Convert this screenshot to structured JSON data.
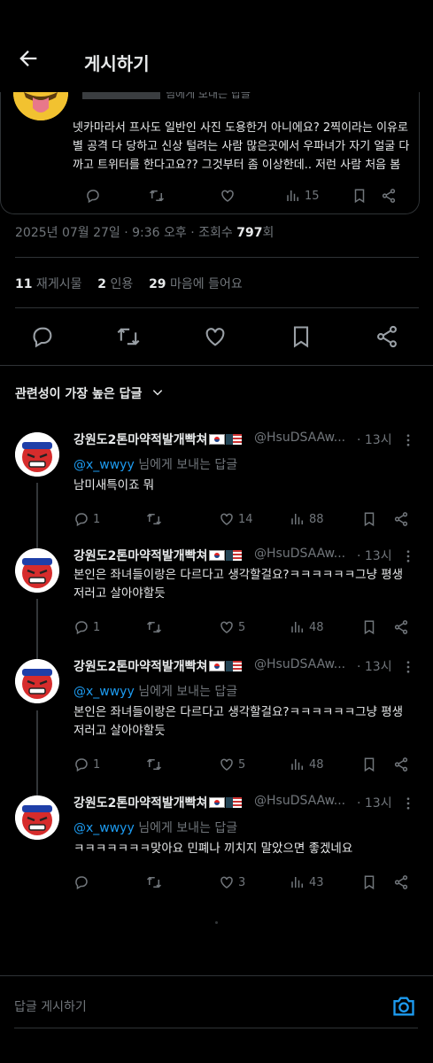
{
  "header": {
    "title": "게시하기"
  },
  "quoted": {
    "reply_to": "님에게 보내는 답글",
    "text": "넷카마라서 프사도 일반인 사진 도용한거 아니에요? 2찍이라는 이유로 별 공격 다 당하고 신상 털려는 사람 많은곳에서 우파녀가 자기 얼굴 다 까고 트위터를 한다고요?? 그것부터 좀 이상한데.. 저런 사람 처음 봄",
    "views": "15"
  },
  "meta": {
    "datetime": "2025년 07월 27일 · 9:36 오후 · 조회수 ",
    "views": "797",
    "views_unit": "회"
  },
  "stats": {
    "reposts_count": "11",
    "reposts_label": " 재게시물",
    "quotes_count": "2",
    "quotes_label": " 인용",
    "likes_count": "29",
    "likes_label": " 마음에 들어요"
  },
  "sort": {
    "label": "관련성이 가장 높은 답글"
  },
  "replies": [
    {
      "name": "강원도2톤마약적발개빡쳐",
      "handle": "@HsuDSAAw...",
      "time": "· 13시",
      "mention": "@x_wwyy",
      "reply_to": " 님에게 보내는 답글",
      "text": "남미새특이죠 뭐",
      "replies": "1",
      "likes": "14",
      "views": "88"
    },
    {
      "name": "강원도2톤마약적발개빡쳐",
      "handle": "@HsuDSAAw...",
      "time": "· 13시",
      "mention": "",
      "reply_to": "",
      "text": "본인은 좌녀들이랑은 다르다고 생각할걸요?ㅋㅋㅋㅋㅋㅋ그냥 평생 저러고 살아야할듯",
      "replies": "1",
      "likes": "5",
      "views": "48"
    },
    {
      "name": "강원도2톤마약적발개빡쳐",
      "handle": "@HsuDSAAw...",
      "time": "· 13시",
      "mention": "@x_wwyy",
      "reply_to": " 님에게 보내는 답글",
      "text": "본인은 좌녀들이랑은 다르다고 생각할걸요?ㅋㅋㅋㅋㅋㅋ그냥 평생 저러고 살아야할듯",
      "replies": "1",
      "likes": "5",
      "views": "48"
    },
    {
      "name": "강원도2톤마약적발개빡쳐",
      "handle": "@HsuDSAAw...",
      "time": "· 13시",
      "mention": "@x_wwyy",
      "reply_to": " 님에게 보내는 답글",
      "text": "ㅋㅋㅋㅋㅋㅋㅋ맞아요 민폐나 끼치지 말았으면 좋겠네요",
      "replies": "",
      "likes": "3",
      "views": "43"
    }
  ],
  "compose": {
    "placeholder": "답글 게시하기"
  },
  "colors": {
    "background": "#000000",
    "text": "#e7e9ea",
    "muted": "#71767b",
    "accent": "#1d9bf0",
    "divider": "#2f3336"
  },
  "icons": [
    "back-arrow-icon",
    "reply-icon",
    "repost-icon",
    "like-icon",
    "views-icon",
    "bookmark-icon",
    "share-icon",
    "more-icon",
    "chevron-down-icon",
    "camera-icon"
  ]
}
